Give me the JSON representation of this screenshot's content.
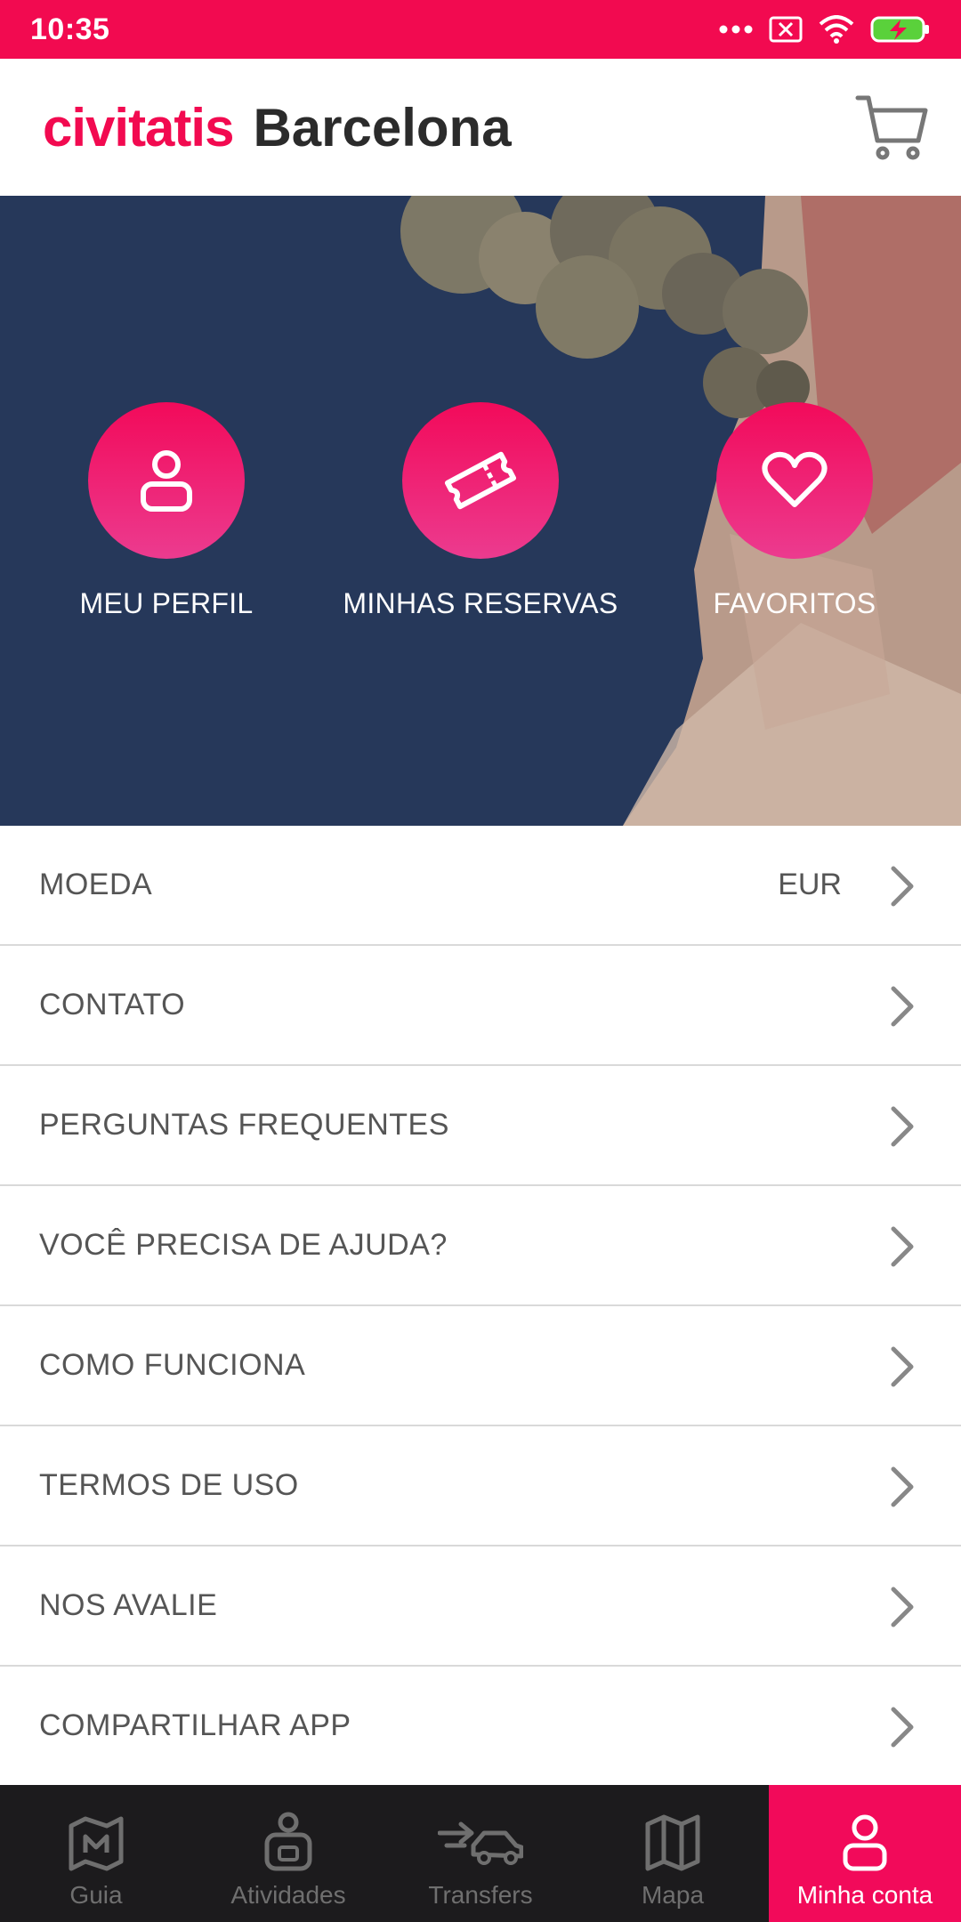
{
  "status_bar": {
    "time": "10:35",
    "icons": [
      "more-dots-icon",
      "sim-off-icon",
      "wifi-icon",
      "battery-charging-icon"
    ]
  },
  "header": {
    "brand": "civitatis",
    "city": "Barcelona",
    "cart_icon": "cart-icon"
  },
  "hero": {
    "actions": [
      {
        "label": "MEU PERFIL",
        "icon": "user-icon"
      },
      {
        "label": "MINHAS RESERVAS",
        "icon": "ticket-icon"
      },
      {
        "label": "FAVORITOS",
        "icon": "heart-icon"
      }
    ]
  },
  "menu": {
    "items": [
      {
        "label": "MOEDA",
        "value": "EUR"
      },
      {
        "label": "CONTATO"
      },
      {
        "label": "PERGUNTAS FREQUENTES"
      },
      {
        "label": "VOCÊ PRECISA DE AJUDA?"
      },
      {
        "label": "COMO FUNCIONA"
      },
      {
        "label": "TERMOS DE USO"
      },
      {
        "label": "NOS AVALIE"
      },
      {
        "label": "COMPARTILHAR APP"
      }
    ]
  },
  "bottom_nav": {
    "items": [
      {
        "label": "Guia",
        "icon": "map-pin-icon"
      },
      {
        "label": "Atividades",
        "icon": "activities-icon"
      },
      {
        "label": "Transfers",
        "icon": "transfer-car-icon"
      },
      {
        "label": "Mapa",
        "icon": "map-icon"
      },
      {
        "label": "Minha conta",
        "icon": "account-icon",
        "active": true
      }
    ]
  },
  "colors": {
    "accent": "#f20a50",
    "hero_background": "#26385a",
    "nav_background": "#1c1b1d"
  }
}
